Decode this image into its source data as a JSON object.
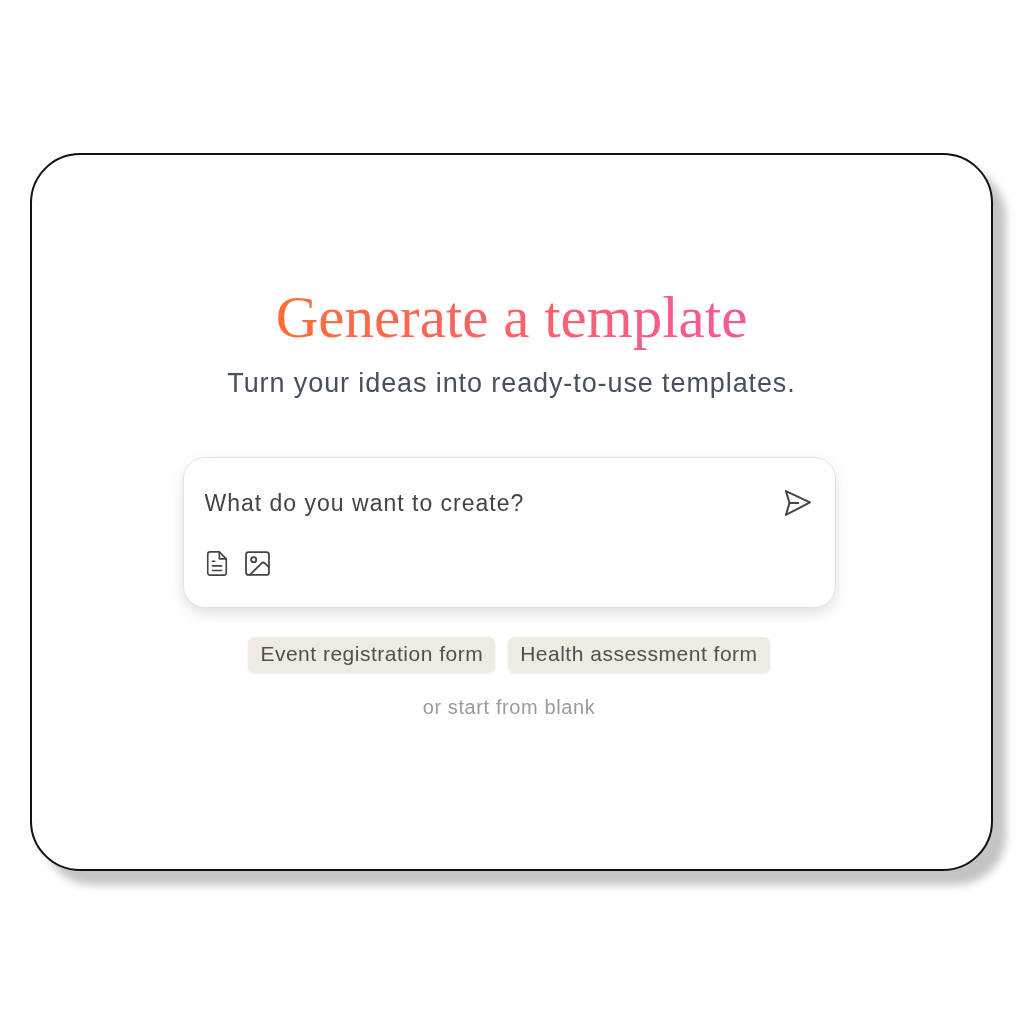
{
  "title": "Generate a template",
  "subtitle": "Turn your ideas into ready-to-use templates.",
  "prompt": {
    "placeholder": "What do you want to create?"
  },
  "suggestions": [
    "Event registration form",
    "Health assessment form"
  ],
  "start_blank": "or start from blank"
}
